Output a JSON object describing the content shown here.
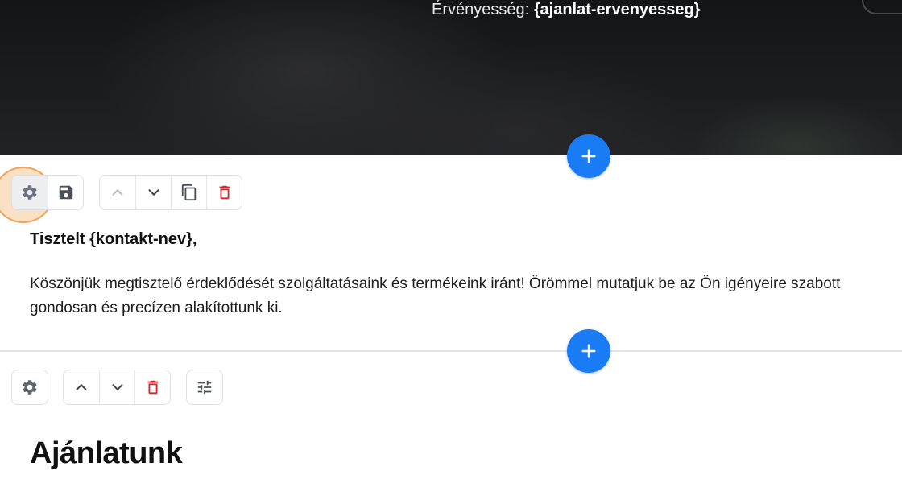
{
  "hero": {
    "validity_label": "Érvényesség:",
    "validity_value": "{ajanlat-ervenyesseg}"
  },
  "block1": {
    "greeting": "Tisztelt {kontakt-nev},",
    "paragraph_line1": "Köszönjük megtisztelő érdeklődését szolgáltatásaink és termékeink iránt! Örömmel mutatjuk be az Ön igényeire szabott",
    "paragraph_line2": "gondosan és precízen alakítottunk ki."
  },
  "block2": {
    "title": "Ajánlatunk"
  },
  "icons": {
    "settings": "gear-icon",
    "save": "save-icon",
    "move_up": "chevron-up-icon",
    "move_down": "chevron-down-icon",
    "duplicate": "copy-icon",
    "delete": "trash-icon",
    "adjust": "sliders-icon",
    "add": "plus-icon"
  },
  "colors": {
    "accent": "#1a7cf5",
    "danger": "#d9262b",
    "icon_gray": "#5f6670",
    "icon_disabled": "#b9bec5",
    "highlight": "#f0a456"
  }
}
